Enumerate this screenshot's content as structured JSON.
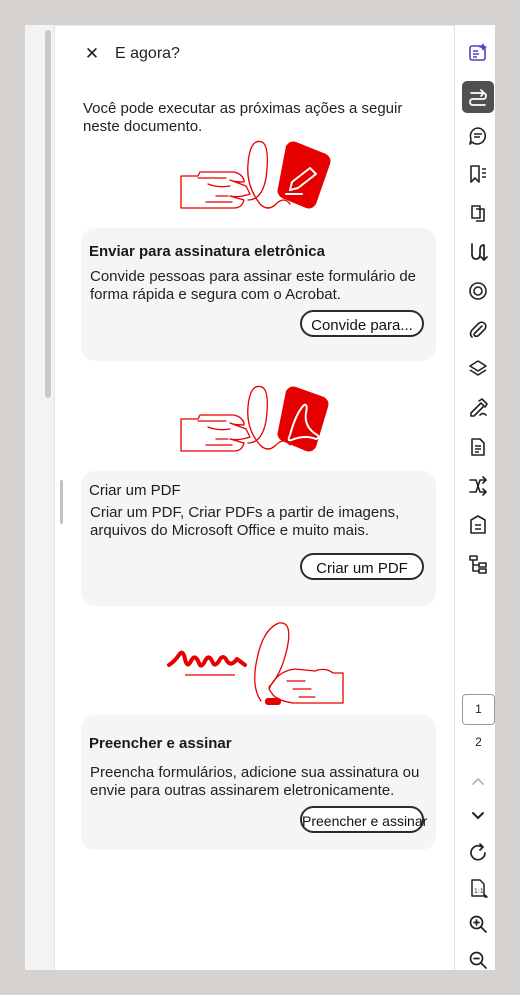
{
  "panel": {
    "close_glyph": "✕",
    "title": "E agora?",
    "intro": "Você pode executar as próximas ações a seguir neste documento."
  },
  "cards": [
    {
      "title": "Enviar para assinatura eletrônica",
      "description": "Convide pessoas para assinar este formulário de forma rápida e segura com o Acrobat.",
      "button": "Convide para...",
      "illustration": "hand-pen-signature-icon"
    },
    {
      "title": "Criar um PDF",
      "description": "Criar um PDF, Criar PDFs a partir de imagens, arquivos do Microsoft Office e muito mais.",
      "button": "Criar um PDF",
      "illustration": "hand-acrobat-pdf-icon"
    },
    {
      "title": "Preencher e assinar",
      "description": "Preencha formulários, adicione sua assinatura ou envie para outras assinarem eletronicamente.",
      "button": "Preencher e assinar",
      "illustration": "hand-signature-stamp-icon"
    }
  ],
  "right_rail": {
    "tools": [
      "ai-assistant-icon",
      "edit-text-icon",
      "comment-icon",
      "bookmarks-icon",
      "pages-icon",
      "combine-icon",
      "stamp-icon",
      "attachment-icon",
      "layers-icon",
      "fill-sign-icon",
      "document-icon",
      "redact-icon",
      "accessibility-icon",
      "content-tree-icon"
    ],
    "active_tool": "edit-text-icon",
    "page_current": "1",
    "page_next": "2",
    "bottom_tools": [
      "page-up-icon",
      "page-down-icon",
      "rotate-icon",
      "actual-size-icon",
      "zoom-in-icon",
      "zoom-out-icon"
    ]
  },
  "colors": {
    "accent": "#e60000",
    "ai_icon": "#5a3fc0",
    "active_bg": "#505050"
  }
}
